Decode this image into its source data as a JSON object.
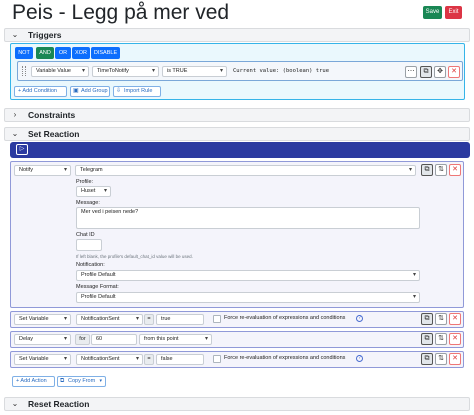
{
  "page": {
    "title": "Peis - Legg på mer ved",
    "save_label": "Save",
    "exit_label": "Exit"
  },
  "triggers": {
    "section_title": "Triggers",
    "toggle_not": "NOT",
    "toggle_and": "AND",
    "toggle_or": "OR",
    "toggle_xor": "XOR",
    "toggle_disable": "DISABLE",
    "condition": {
      "type": "Variable Value",
      "variable": "TimeToNotify",
      "operator": "is TRUE",
      "current_value": "Current value: (boolean) true"
    },
    "add_condition": "+ Add Condition",
    "add_group": "Add Group",
    "import_rule": "Import Rule"
  },
  "constraints": {
    "section_title": "Constraints"
  },
  "set_reaction": {
    "section_title": "Set Reaction",
    "notify": {
      "action": "Notify",
      "target": "Telegram",
      "profile_label": "Profile:",
      "profile_value": "Huset",
      "message_label": "Message:",
      "message_value": "Mer ved i peisen nede?",
      "chat_id_label": "Chat ID",
      "chat_id_help": "If left blank, the profile's default_chat_id value will be used.",
      "notification_label": "Notification:",
      "notification_value": "Profile Default",
      "message_format_label": "Message Format:",
      "message_format_value": "Profile Default"
    },
    "set_variable_1": {
      "action": "Set Variable",
      "variable": "NotificationSent",
      "eq": "=",
      "value": "true",
      "force_label": "Force re-evaluation of expressions and conditions"
    },
    "delay": {
      "action": "Delay",
      "for_label": "for",
      "value": "60",
      "mode": "from this point"
    },
    "set_variable_2": {
      "action": "Set Variable",
      "variable": "NotificationSent",
      "eq": "=",
      "value": "false",
      "force_label": "Force re-evaluation of expressions and conditions"
    },
    "add_action": "+ Add Action",
    "copy_from": "Copy From"
  },
  "reset_reaction": {
    "section_title": "Reset Reaction"
  },
  "icons": {
    "chevron": "chevron-down-icon",
    "play": "play-icon",
    "more": "more-icon",
    "copy": "copy-icon",
    "move": "move-icon",
    "reorder": "reorder-icon",
    "close": "close-icon",
    "help": "help-icon",
    "plus": "plus-icon",
    "import": "import-icon"
  },
  "colors": {
    "save": "#198754",
    "exit": "#dc3545",
    "not": "#0d6efd",
    "and": "#198754",
    "logic": "#0d6efd",
    "trigger_border": "#35b4e8",
    "reaction_bar": "#2b3aa0"
  }
}
